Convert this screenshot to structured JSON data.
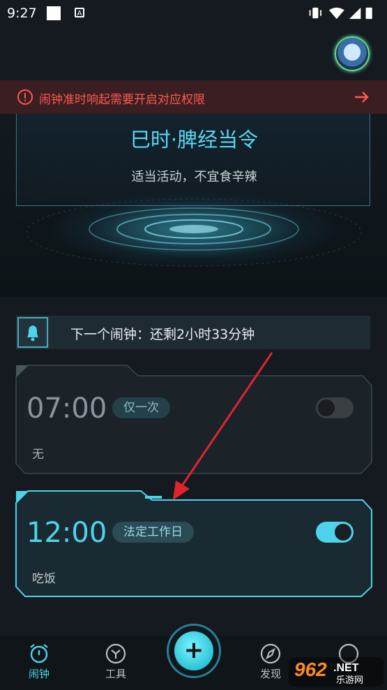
{
  "status_bar": {
    "time": "9:27",
    "a_icon_label": "A"
  },
  "warning": {
    "text": "闹钟准时响起需要开启对应权限"
  },
  "hero": {
    "title": "巳时·脾经当令",
    "subtitle": "适当活动，不宜食辛辣"
  },
  "next_alarm": {
    "text": "下一个闹钟：还剩2小时33分钟"
  },
  "alarms": [
    {
      "time": "07:00",
      "repeat": "仅一次",
      "label": "无",
      "enabled": false
    },
    {
      "time": "12:00",
      "repeat": "法定工作日",
      "label": "吃饭",
      "enabled": true
    }
  ],
  "nav": [
    {
      "label": "闹钟",
      "icon": "alarm-clock-icon",
      "active": true
    },
    {
      "label": "工具",
      "icon": "tools-icon",
      "active": false
    },
    {
      "label": "发现",
      "icon": "compass-icon",
      "active": false
    }
  ],
  "fab": {
    "label": "+"
  },
  "watermark": {
    "text": "962.NET",
    "sub": "乐游网"
  },
  "colors": {
    "accent": "#4fd3ea",
    "warning": "#ff5a4f",
    "annotation_arrow": "#e0242a"
  }
}
